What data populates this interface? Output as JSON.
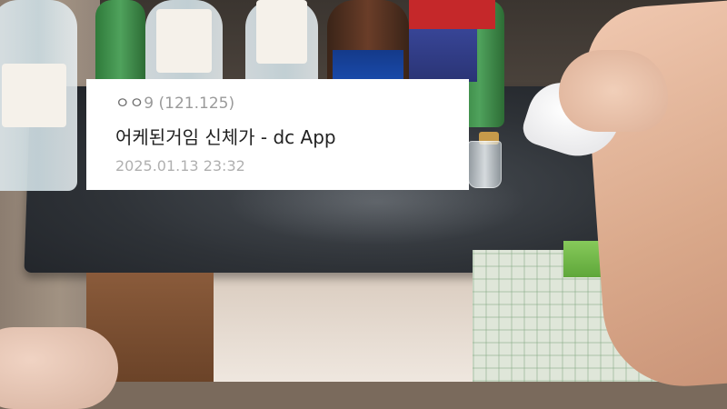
{
  "caption": {
    "author_nick": "ㅇㅇ",
    "author_suffix": "9",
    "author_ip": "(121.125)",
    "title": "어케된거임 신체가 - dc App",
    "timestamp": "2025.01.13 23:32"
  },
  "colors": {
    "caption_bg": "#ffffff",
    "title_text": "#222222",
    "meta_text": "#9a9a9a"
  }
}
